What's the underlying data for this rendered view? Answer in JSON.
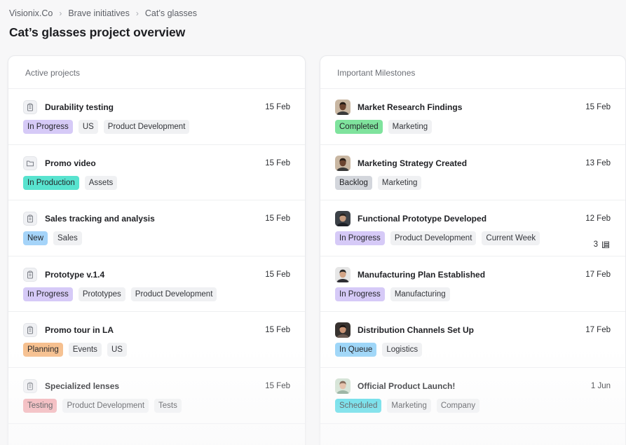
{
  "breadcrumb": {
    "items": [
      "Visionix.Co",
      "Brave initiatives",
      "Cat’s glasses"
    ]
  },
  "page_title": "Cat’s glasses project overview",
  "colors": {
    "in_progress": "#d6caf7",
    "in_production": "#58e3cf",
    "new": "#a5d4f9",
    "planning": "#f6c08f",
    "testing": "#f3a9ae",
    "completed": "#7fe39d",
    "backlog": "#d3d6dc",
    "in_queue": "#9ed6f8",
    "scheduled": "#47d8e6",
    "neutral_tag": "#f0f1f3"
  },
  "active_projects": {
    "title": "Active projects",
    "items": [
      {
        "name": "Durability testing",
        "date": "15 Feb",
        "icon": "clipboard-icon",
        "tags": [
          {
            "label": "In Progress",
            "color": "#d6caf7"
          },
          {
            "label": "US"
          },
          {
            "label": "Product Development"
          }
        ]
      },
      {
        "name": "Promo video",
        "date": "15 Feb",
        "icon": "folder-icon",
        "tags": [
          {
            "label": "In Production",
            "color": "#58e3cf"
          },
          {
            "label": "Assets"
          }
        ]
      },
      {
        "name": "Sales tracking and analysis",
        "date": "15 Feb",
        "icon": "clipboard-icon",
        "tags": [
          {
            "label": "New",
            "color": "#a5d4f9"
          },
          {
            "label": "Sales"
          }
        ]
      },
      {
        "name": "Prototype v.1.4",
        "date": "15 Feb",
        "icon": "clipboard-icon",
        "tags": [
          {
            "label": "In Progress",
            "color": "#d6caf7"
          },
          {
            "label": "Prototypes"
          },
          {
            "label": "Product Development"
          }
        ]
      },
      {
        "name": "Promo tour in LA",
        "date": "15 Feb",
        "icon": "clipboard-icon",
        "tags": [
          {
            "label": "Planning",
            "color": "#f6c08f"
          },
          {
            "label": "Events"
          },
          {
            "label": "US"
          }
        ]
      },
      {
        "name": "Specialized lenses",
        "date": "15 Feb",
        "icon": "clipboard-icon",
        "tags": [
          {
            "label": "Testing",
            "color": "#f3a9ae"
          },
          {
            "label": "Product Development"
          },
          {
            "label": "Tests"
          }
        ]
      }
    ]
  },
  "milestones": {
    "title": "Important Milestones",
    "items": [
      {
        "name": "Market Research Findings",
        "date": "15 Feb",
        "avatar": "avatar-1",
        "tags": [
          {
            "label": "Completed",
            "color": "#7fe39d"
          },
          {
            "label": "Marketing"
          }
        ]
      },
      {
        "name": "Marketing Strategy Created",
        "date": "13 Feb",
        "avatar": "avatar-1",
        "tags": [
          {
            "label": "Backlog",
            "color": "#d3d6dc"
          },
          {
            "label": "Marketing"
          }
        ]
      },
      {
        "name": "Functional Prototype Developed",
        "date": "12 Feb",
        "avatar": "avatar-2",
        "tags": [
          {
            "label": "In Progress",
            "color": "#d6caf7"
          },
          {
            "label": "Product Development"
          },
          {
            "label": "Current Week"
          }
        ],
        "extra": "3"
      },
      {
        "name": "Manufacturing Plan Established",
        "date": "17 Feb",
        "avatar": "avatar-3",
        "tags": [
          {
            "label": "In Progress",
            "color": "#d6caf7"
          },
          {
            "label": "Manufacturing"
          }
        ]
      },
      {
        "name": "Distribution Channels Set Up",
        "date": "17 Feb",
        "avatar": "avatar-4",
        "tags": [
          {
            "label": "In Queue",
            "color": "#9ed6f8"
          },
          {
            "label": "Logistics"
          }
        ]
      },
      {
        "name": "Official Product Launch!",
        "date": "1 Jun",
        "avatar": "avatar-5",
        "tags": [
          {
            "label": "Scheduled",
            "color": "#47d8e6"
          },
          {
            "label": "Marketing"
          },
          {
            "label": "Company"
          }
        ]
      }
    ]
  }
}
